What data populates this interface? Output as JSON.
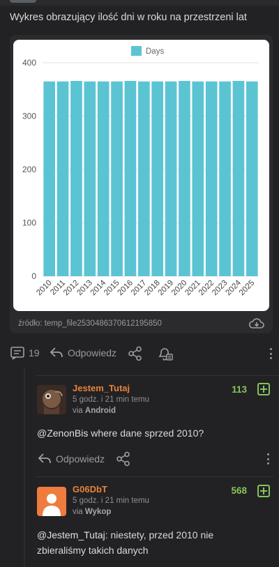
{
  "post": {
    "text": "Wykres obrazujący ilość dni w roku na przestrzeni lat",
    "source_label": "źródło: temp_file2530486370612195850",
    "comments_count": "19",
    "reply_label": "Odpowiedz"
  },
  "chart_data": {
    "type": "bar",
    "categories": [
      "2010",
      "2011",
      "2012",
      "2013",
      "2014",
      "2015",
      "2016",
      "2017",
      "2018",
      "2019",
      "2020",
      "2021",
      "2022",
      "2023",
      "2024",
      "2025"
    ],
    "series": [
      {
        "name": "Days",
        "values": [
          365,
          365,
          366,
          365,
          365,
          365,
          366,
          365,
          365,
          365,
          366,
          365,
          365,
          365,
          366,
          365
        ]
      }
    ],
    "ylim": [
      0,
      400
    ],
    "yticks": [
      0,
      100,
      200,
      300,
      400
    ],
    "legend": "top-center",
    "grid": true,
    "bar_color": "#5bc4d3",
    "title": "",
    "xlabel": "",
    "ylabel": ""
  },
  "comments": [
    {
      "user": "Jestem_Tutaj",
      "time": "5 godz. i 21 min temu",
      "via_prefix": "via ",
      "via_app": "Android",
      "votes": "113",
      "mention": "@ZenonBis",
      "text": " where dane sprzed 2010?",
      "reply_label": "Odpowiedz"
    },
    {
      "user": "G06DbT",
      "time": "5 godz. i 21 min temu",
      "via_prefix": "via ",
      "via_app": "Wykop",
      "votes": "568",
      "mention": "@Jestem_Tutaj",
      "text": ": niestety, przed 2010 nie zbieraliśmy takich danych"
    }
  ],
  "colors": {
    "background": "#222224",
    "username": "#e8823a",
    "votes": "#86c35c",
    "avatar_default": "#f07b3f"
  }
}
